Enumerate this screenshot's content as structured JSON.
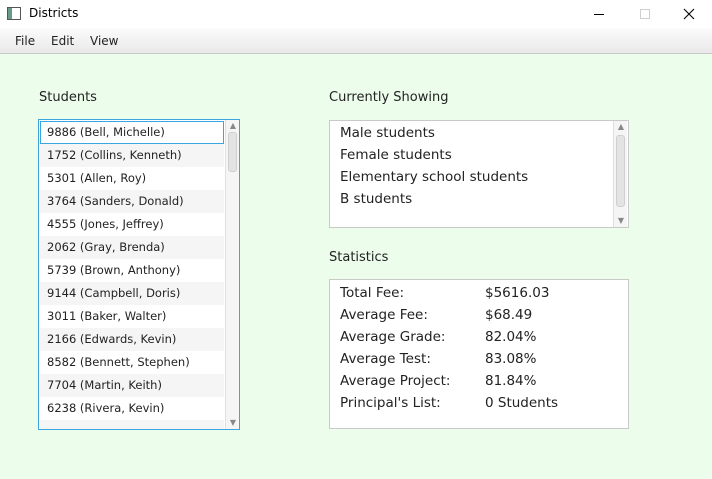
{
  "window": {
    "title": "Districts",
    "icon": "app-window-icon"
  },
  "menu": {
    "items": [
      "File",
      "Edit",
      "View"
    ]
  },
  "students": {
    "heading": "Students",
    "items": [
      "9886 (Bell, Michelle)",
      "1752 (Collins, Kenneth)",
      "5301 (Allen, Roy)",
      "3764 (Sanders, Donald)",
      "4555 (Jones, Jeffrey)",
      "2062 (Gray, Brenda)",
      "5739 (Brown, Anthony)",
      "9144 (Campbell, Doris)",
      "3011 (Baker, Walter)",
      "2166 (Edwards, Kevin)",
      "8582 (Bennett, Stephen)",
      "7704 (Martin, Keith)",
      "6238 (Rivera, Kevin)"
    ],
    "selected_index": 0
  },
  "showing": {
    "heading": "Currently Showing",
    "items": [
      "Male students",
      "Female students",
      "Elementary school students",
      "B students"
    ]
  },
  "statistics": {
    "heading": "Statistics",
    "rows": [
      {
        "label": "Total Fee:",
        "value": "$5616.03"
      },
      {
        "label": "Average Fee:",
        "value": "$68.49"
      },
      {
        "label": "Average Grade:",
        "value": "82.04%"
      },
      {
        "label": "Average Test:",
        "value": "83.08%"
      },
      {
        "label": "Average Project:",
        "value": "81.84%"
      },
      {
        "label": "Principal's List:",
        "value": "0 Students"
      }
    ]
  },
  "colors": {
    "content_bg": "#ecfdec",
    "focus_border": "#3aa6dd"
  }
}
